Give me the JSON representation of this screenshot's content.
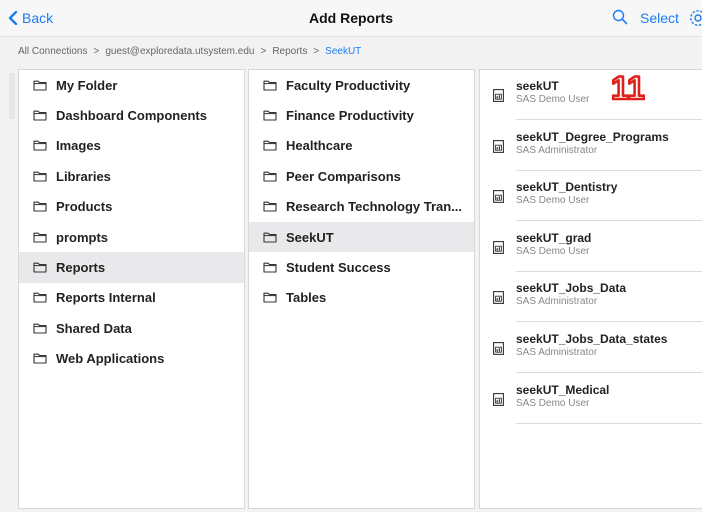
{
  "nav": {
    "back_label": "Back",
    "title": "Add Reports",
    "select_label": "Select"
  },
  "breadcrumb": {
    "items": [
      "All Connections",
      "guest@exploredata.utsystem.edu",
      "Reports",
      "SeekUT"
    ]
  },
  "column1": {
    "folders": [
      "My Folder",
      "Dashboard Components",
      "Images",
      "Libraries",
      "Products",
      "prompts",
      "Reports",
      "Reports Internal",
      "Shared Data",
      "Web Applications"
    ],
    "selected": "Reports"
  },
  "column2": {
    "folders": [
      "Faculty Productivity",
      "Finance Productivity",
      "Healthcare",
      "Peer Comparisons",
      "Research Technology Tran...",
      "SeekUT",
      "Student Success",
      "Tables"
    ],
    "selected": "SeekUT"
  },
  "column3": {
    "reports": [
      {
        "name": "seekUT",
        "owner": "SAS Demo User"
      },
      {
        "name": "seekUT_Degree_Programs",
        "owner": "SAS Administrator"
      },
      {
        "name": "seekUT_Dentistry",
        "owner": "SAS Demo User"
      },
      {
        "name": "seekUT_grad",
        "owner": "SAS Demo User"
      },
      {
        "name": "seekUT_Jobs_Data",
        "owner": "SAS Administrator"
      },
      {
        "name": "seekUT_Jobs_Data_states",
        "owner": "SAS Administrator"
      },
      {
        "name": "seekUT_Medical",
        "owner": "SAS Demo User"
      }
    ]
  },
  "annotation": {
    "number": "11"
  },
  "colors": {
    "accent": "#1a7cf5",
    "badge": "#e0201b",
    "selected_row": "#e9e9ec"
  }
}
